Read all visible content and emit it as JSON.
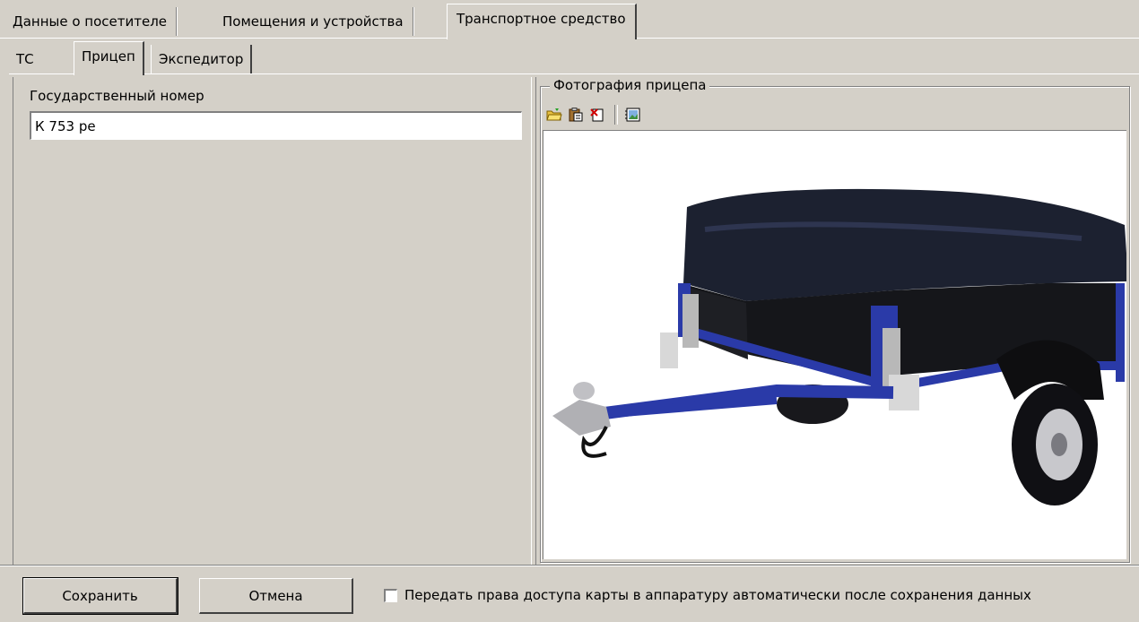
{
  "tabs": [
    {
      "label": "Данные о посетителе"
    },
    {
      "label": "Помещения и устройства"
    },
    {
      "label": "Транспортное средство"
    }
  ],
  "subtabs": [
    {
      "label": "ТС"
    },
    {
      "label": "Прицеп"
    },
    {
      "label": "Экспедитор"
    }
  ],
  "form": {
    "plate_label": "Государственный номер",
    "plate_value": "К 753 ре"
  },
  "photo": {
    "group_title": "Фотография прицепа",
    "toolbar_icons": [
      "open-folder-icon",
      "paste-icon",
      "clear-icon",
      "image-properties-icon"
    ],
    "image_subject": "trailer-photo"
  },
  "bottom": {
    "save_label": "Сохранить",
    "cancel_label": "Отмена",
    "checkbox_label": "Передать права доступа карты в аппаратуру автоматически после сохранения данных",
    "checkbox_checked": false
  }
}
